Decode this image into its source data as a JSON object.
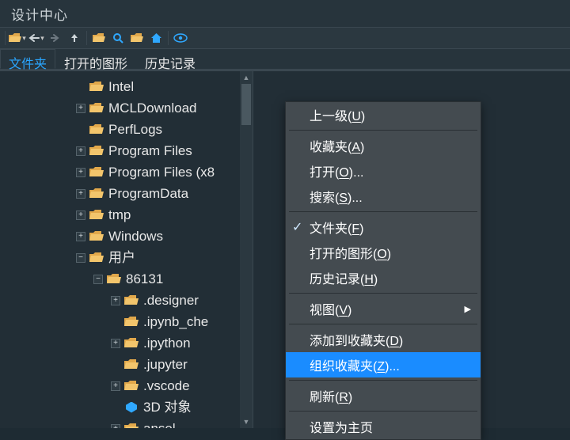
{
  "title": "设计中心",
  "toolbar_icons": [
    "load",
    "back",
    "fwd",
    "up",
    "folder",
    "search",
    "fav",
    "home",
    "view"
  ],
  "tabs": [
    {
      "label": "文件夹",
      "active": true
    },
    {
      "label": "打开的图形",
      "active": false
    },
    {
      "label": "历史记录",
      "active": false
    }
  ],
  "tree": [
    {
      "depth": 3,
      "exp": "",
      "icon": "folder",
      "label": "Intel"
    },
    {
      "depth": 3,
      "exp": "+",
      "icon": "folder",
      "label": "MCLDownload"
    },
    {
      "depth": 3,
      "exp": "",
      "icon": "folder",
      "label": "PerfLogs"
    },
    {
      "depth": 3,
      "exp": "+",
      "icon": "folder",
      "label": "Program Files"
    },
    {
      "depth": 3,
      "exp": "+",
      "icon": "folder",
      "label": "Program Files (x8"
    },
    {
      "depth": 3,
      "exp": "+",
      "icon": "folder",
      "label": "ProgramData"
    },
    {
      "depth": 3,
      "exp": "+",
      "icon": "folder",
      "label": "tmp"
    },
    {
      "depth": 3,
      "exp": "+",
      "icon": "folder",
      "label": "Windows"
    },
    {
      "depth": 3,
      "exp": "-",
      "icon": "folder",
      "label": "用户"
    },
    {
      "depth": 4,
      "exp": "-",
      "icon": "folder",
      "label": "86131"
    },
    {
      "depth": 5,
      "exp": "+",
      "icon": "folder",
      "label": ".designer"
    },
    {
      "depth": 5,
      "exp": "",
      "icon": "folder",
      "label": ".ipynb_che"
    },
    {
      "depth": 5,
      "exp": "+",
      "icon": "folder",
      "label": ".ipython"
    },
    {
      "depth": 5,
      "exp": "",
      "icon": "folder",
      "label": ".jupyter"
    },
    {
      "depth": 5,
      "exp": "+",
      "icon": "folder",
      "label": ".vscode"
    },
    {
      "depth": 5,
      "exp": "",
      "icon": "cube",
      "label": "3D 对象"
    },
    {
      "depth": 5,
      "exp": "+",
      "icon": "folder",
      "label": "ansel"
    }
  ],
  "context_menu": [
    {
      "type": "item",
      "text": "上一级",
      "hot": "U"
    },
    {
      "type": "sep"
    },
    {
      "type": "item",
      "text": "收藏夹",
      "hot": "A"
    },
    {
      "type": "item",
      "text": "打开",
      "hot": "O",
      "trail": "..."
    },
    {
      "type": "item",
      "text": "搜索",
      "hot": "S",
      "trail": "..."
    },
    {
      "type": "sep"
    },
    {
      "type": "item",
      "text": "文件夹",
      "hot": "F",
      "checked": true
    },
    {
      "type": "item",
      "text": "打开的图形",
      "hot": "O"
    },
    {
      "type": "item",
      "text": "历史记录",
      "hot": "H"
    },
    {
      "type": "sep"
    },
    {
      "type": "item",
      "text": "视图",
      "hot": "V",
      "submenu": true
    },
    {
      "type": "sep"
    },
    {
      "type": "item",
      "text": "添加到收藏夹",
      "hot": "D"
    },
    {
      "type": "item",
      "text": "组织收藏夹",
      "hot": "Z",
      "trail": "...",
      "highlight": true
    },
    {
      "type": "sep"
    },
    {
      "type": "item",
      "text": "刷新",
      "hot": "R"
    },
    {
      "type": "sep"
    },
    {
      "type": "item",
      "text": "设置为主页"
    }
  ]
}
